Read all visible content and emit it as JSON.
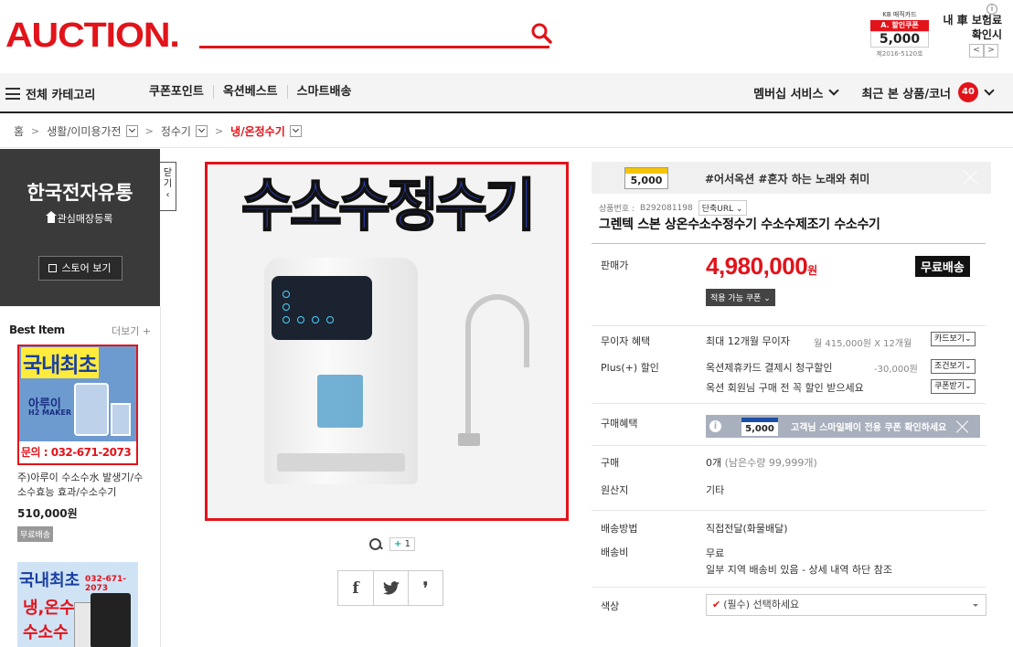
{
  "header": {
    "logo": "AUCTION.",
    "search_placeholder": "",
    "ad": {
      "top": "KB 매직카드",
      "coupon_label": "A. 할인쿠폰",
      "amount": "5,000",
      "bottom": "제2016-5120호"
    },
    "side_promo": "내 車 보험료 확인시",
    "info_label": "i",
    "prev_label": "<",
    "next_label": ">"
  },
  "nav": {
    "category_label": "전체 카테고리",
    "links": [
      "쿠폰포인트",
      "옥션베스트",
      "스마트배송"
    ],
    "membership_label": "멤버십 서비스",
    "recent_label": "최근 본 상품/코너",
    "recent_count": "40"
  },
  "breadcrumb": {
    "home": "홈",
    "level1": "생활/이미용가전",
    "level2": "정수기",
    "level3": "냉/온정수기"
  },
  "store": {
    "name": "한국전자유통",
    "favorite_label": "관심매장등록",
    "view_button": "스토어 보기",
    "close_tab": "닫기"
  },
  "best": {
    "title": "Best Item",
    "more": "더보기 +",
    "item1": {
      "img_title": "국내최초",
      "img_brand": "아루이",
      "img_sub": "H2 MAKER",
      "img_phone": "문의 : 032-671-2073",
      "desc": "주)아루이 수소수水 발생기/수소수효능 효과/수소수기",
      "price": "510,000원",
      "shipping": "무료배송"
    },
    "item2": {
      "img_title": "국내최초",
      "img_line2": "냉,온수",
      "img_line3": "수소수",
      "img_phone": "032-671-2073"
    }
  },
  "gallery": {
    "image_title": "수소수정수기",
    "image_count": "1",
    "share": {
      "facebook": "f",
      "twitter": "t",
      "other": "❜"
    }
  },
  "product": {
    "coupon_amount": "5,000",
    "coupon_text": "#어서옥션 #혼자 하는 노래와 취미",
    "product_no_label": "상품번호 :",
    "product_no": "B292081198",
    "short_url": "단축URL",
    "title": "그렌텍 스본 상온수소수정수기 수소수제조기 수소수기",
    "price_label": "판매가",
    "price": "4,980,000",
    "price_unit": "원",
    "free_shipping": "무료배송",
    "apply_coupon": "적용 가능 쿠폰",
    "installment_label": "무이자 혜택",
    "installment": "최대 12개월 무이자",
    "installment_detail": "월 415,000원 X 12개월",
    "card_view": "카드보기",
    "plus_label": "Plus(+) 할인",
    "plus": "옥션제휴카드 결제시 청구할인",
    "plus_amount": "-30,000원",
    "condition_view": "조건보기",
    "member_discount": "옥션 회원님 구매 전 꼭 할인 받으세요",
    "coupon_receive": "쿠폰받기",
    "purchase_benefit_label": "구매혜택",
    "smile_info": "i",
    "smile_amount": "5,000",
    "smile_text": "고객님 스마일페이 전용 쿠폰 확인하세요",
    "purchase_label": "구매",
    "purchase": "0개",
    "purchase_stock": "(남은수량 99,999개)",
    "origin_label": "원산지",
    "origin": "기타",
    "delivery_method_label": "배송방법",
    "delivery_method": "직접전달(화물배달)",
    "delivery_fee_label": "배송비",
    "delivery_fee": "무료",
    "delivery_note": "일부 지역 배송비 있음 - 상세 내역 하단 참조",
    "color_label": "색상",
    "color_select": "(필수) 선택하세요"
  }
}
